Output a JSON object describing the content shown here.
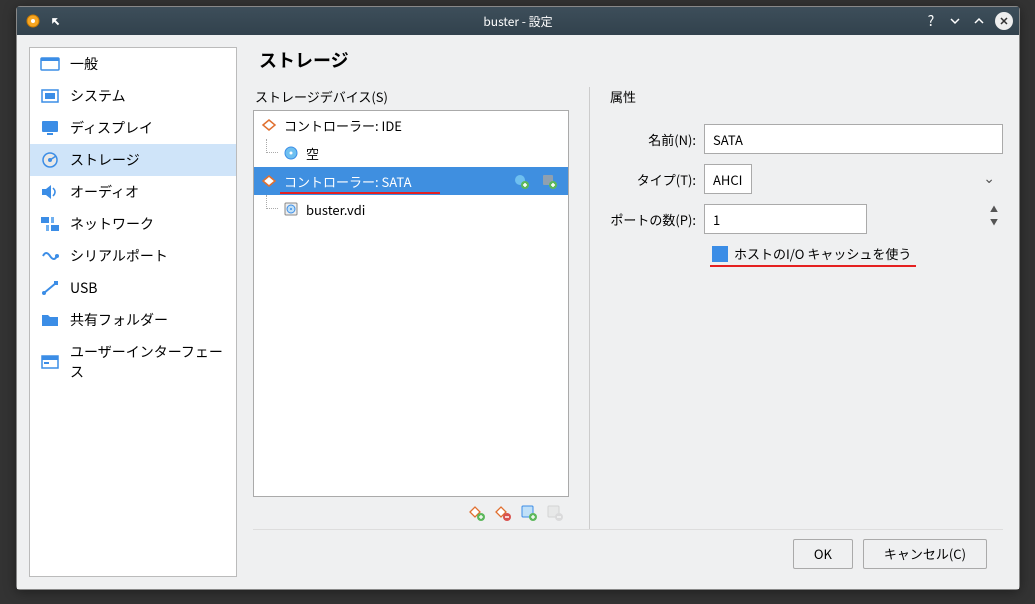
{
  "window": {
    "title": "buster - 設定"
  },
  "sidebar": {
    "items": [
      {
        "label": "一般",
        "icon": "general"
      },
      {
        "label": "システム",
        "icon": "system"
      },
      {
        "label": "ディスプレイ",
        "icon": "display"
      },
      {
        "label": "ストレージ",
        "icon": "storage",
        "selected": true
      },
      {
        "label": "オーディオ",
        "icon": "audio"
      },
      {
        "label": "ネットワーク",
        "icon": "network"
      },
      {
        "label": "シリアルポート",
        "icon": "serial"
      },
      {
        "label": "USB",
        "icon": "usb"
      },
      {
        "label": "共有フォルダー",
        "icon": "shared"
      },
      {
        "label": "ユーザーインターフェース",
        "icon": "ui"
      }
    ]
  },
  "main": {
    "heading": "ストレージ",
    "devices_label": "ストレージデバイス(S)",
    "tree": {
      "ide_controller": "コントローラー: IDE",
      "ide_empty": "空",
      "sata_controller": "コントローラー: SATA",
      "sata_disk": "buster.vdi"
    },
    "attrs": {
      "section_label": "属性",
      "name_label": "名前(N):",
      "name_value": "SATA",
      "type_label": "タイプ(T):",
      "type_value": "AHCI",
      "ports_label": "ポートの数(P):",
      "ports_value": "1",
      "io_cache_label": "ホストのI/O キャッシュを使う",
      "io_cache_checked": true
    }
  },
  "buttons": {
    "ok": "OK",
    "cancel": "キャンセル(C)"
  }
}
